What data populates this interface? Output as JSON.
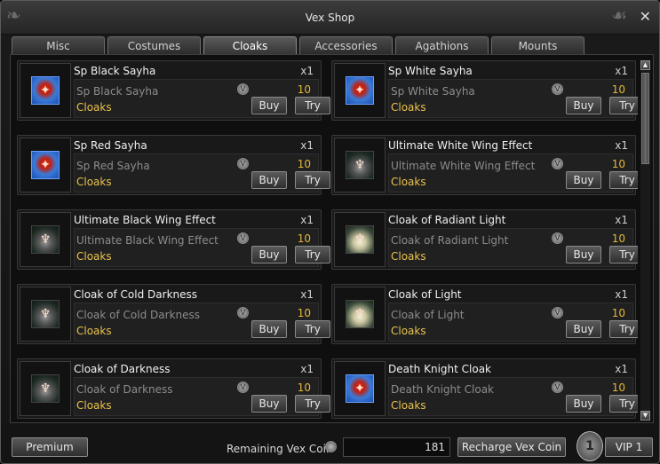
{
  "window": {
    "title": "Vex Shop",
    "close_glyph": "✕"
  },
  "tabs": [
    "Misc",
    "Costumes",
    "Cloaks",
    "Accessories",
    "Agathions",
    "Mounts"
  ],
  "active_tab": "Cloaks",
  "items": [
    {
      "name": "Sp Black Sayha",
      "qty": "x1",
      "sub": "Sp Black Sayha",
      "category": "Cloaks",
      "price": "10",
      "icon": "sayha-blue-icon",
      "buy": "Buy",
      "try": "Try"
    },
    {
      "name": "Sp White Sayha",
      "qty": "x1",
      "sub": "Sp White Sayha",
      "category": "Cloaks",
      "price": "10",
      "icon": "sayha-blue-icon",
      "buy": "Buy",
      "try": "Try"
    },
    {
      "name": "Sp Red Sayha",
      "qty": "x1",
      "sub": "Sp Red Sayha",
      "category": "Cloaks",
      "price": "10",
      "icon": "sayha-blue-icon",
      "buy": "Buy",
      "try": "Try"
    },
    {
      "name": "Ultimate White Wing Effect",
      "qty": "x1",
      "sub": "Ultimate White Wing Effect",
      "category": "Cloaks",
      "price": "10",
      "icon": "dark-cloak-icon",
      "buy": "Buy",
      "try": "Try"
    },
    {
      "name": "Ultimate Black Wing Effect",
      "qty": "x1",
      "sub": "Ultimate Black Wing Effect",
      "category": "Cloaks",
      "price": "10",
      "icon": "dark-cloak-icon",
      "buy": "Buy",
      "try": "Try"
    },
    {
      "name": "Cloak of Radiant Light",
      "qty": "x1",
      "sub": "Cloak of Radiant Light",
      "category": "Cloaks",
      "price": "10",
      "icon": "light-cloak-icon",
      "buy": "Buy",
      "try": "Try"
    },
    {
      "name": "Cloak of Cold Darkness",
      "qty": "x1",
      "sub": "Cloak of Cold Darkness",
      "category": "Cloaks",
      "price": "10",
      "icon": "dark-cloak-icon",
      "buy": "Buy",
      "try": "Try"
    },
    {
      "name": "Cloak of Light",
      "qty": "x1",
      "sub": "Cloak of Light",
      "category": "Cloaks",
      "price": "10",
      "icon": "light-cloak-icon",
      "buy": "Buy",
      "try": "Try"
    },
    {
      "name": "Cloak of Darkness",
      "qty": "x1",
      "sub": "Cloak of Darkness",
      "category": "Cloaks",
      "price": "10",
      "icon": "dark-cloak-icon",
      "buy": "Buy",
      "try": "Try"
    },
    {
      "name": "Death Knight Cloak",
      "qty": "x1",
      "sub": "Death Knight Cloak",
      "category": "Cloaks",
      "price": "10",
      "icon": "sayha-blue-icon",
      "buy": "Buy",
      "try": "Try"
    }
  ],
  "footer": {
    "premium_label": "Premium",
    "remaining_label": "Remaining Vex Coin",
    "coin_value": "181",
    "recharge_label": "Recharge Vex Coin",
    "vip_label": "VIP 1",
    "vip_level": "1"
  },
  "colors": {
    "accent_gold": "#e3b53a",
    "category_yellow": "#e9c24c"
  }
}
